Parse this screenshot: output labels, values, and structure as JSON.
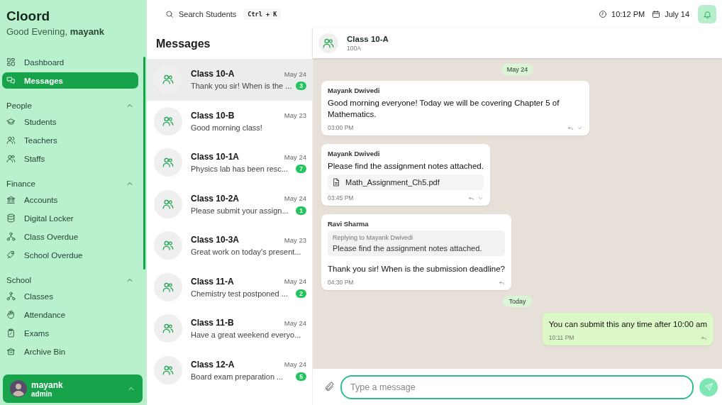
{
  "app": {
    "name": "Cloord",
    "greeting": "Good Evening, **mayank**"
  },
  "sidebar": {
    "items": [
      {
        "label": "Dashboard",
        "selected": false
      },
      {
        "label": "Messages",
        "selected": true
      }
    ],
    "sections": [
      {
        "title": "People",
        "expanded": true,
        "items": [
          {
            "label": "Students",
            "selected": false
          },
          {
            "label": "Teachers",
            "selected": false
          },
          {
            "label": "Staffs",
            "selected": false
          }
        ]
      },
      {
        "title": "Finance",
        "expanded": true,
        "items": [
          {
            "label": "Accounts",
            "selected": false
          },
          {
            "label": "Digital Locker",
            "selected": false
          },
          {
            "label": "Class Overdue",
            "selected": false
          },
          {
            "label": "School Overdue",
            "selected": false
          }
        ]
      },
      {
        "title": "School",
        "expanded": true,
        "items": [
          {
            "label": "Classes",
            "selected": false
          },
          {
            "label": "Attendance",
            "selected": false
          },
          {
            "label": "Exams",
            "selected": false
          },
          {
            "label": "Archive Bin",
            "selected": false
          }
        ]
      }
    ]
  },
  "user": {
    "name": "mayank",
    "role": "admin"
  },
  "topbar": {
    "search": {
      "placeholder": "Search Students",
      "shortcut": "Ctrl + K"
    },
    "time": "10:12 PM",
    "date": "July 14"
  },
  "conversations": {
    "title": "Messages",
    "items": [
      {
        "name": "Class 10-A",
        "date": "May 24",
        "preview": "Thank you sir! When is the ...",
        "unread": "3",
        "selected": true
      },
      {
        "name": "Class 10-B",
        "date": "May 23",
        "preview": "Good morning class!",
        "selected": false
      },
      {
        "name": "Class 10-1A",
        "date": "May 24",
        "preview": "Physics lab has been resc...",
        "unread": "7",
        "selected": false
      },
      {
        "name": "Class 10-2A",
        "date": "May 24",
        "preview": "Please submit your assign...",
        "unread": "1",
        "selected": false
      },
      {
        "name": "Class 10-3A",
        "date": "May 23",
        "preview": "Great work on today's present...",
        "selected": false
      },
      {
        "name": "Class 11-A",
        "date": "May 24",
        "preview": "Chemistry test postponed ...",
        "unread": "2",
        "selected": false
      },
      {
        "name": "Class 11-B",
        "date": "May 24",
        "preview": "Have a great weekend everyo...",
        "selected": false
      },
      {
        "name": "Class 12-A",
        "date": "May 24",
        "preview": "Board exam preparation ...",
        "unread": "5",
        "selected": false
      }
    ]
  },
  "chat": {
    "title": "Class 10-A",
    "subtitle": "100A",
    "messages": [
      {
        "kind": "divider",
        "text": "May 24"
      },
      {
        "kind": "incoming",
        "sender": "Mayank Dwivedi",
        "text": "Good morning everyone! Today we will be covering Chapter 5 of Mathematics.",
        "time": "03:00 PM",
        "menu": true
      },
      {
        "kind": "incoming",
        "sender": "Mayank Dwivedi",
        "text": "Please find the assignment notes attached.",
        "attachment": "Math_Assignment_Ch5.pdf",
        "time": "03:45 PM",
        "menu": true
      },
      {
        "kind": "incoming",
        "sender": "Ravi Sharma",
        "reply_to": {
          "label": "Replying to Mayank Dwivedi",
          "text": "Please find the assignment notes attached."
        },
        "text": "Thank you sir! When is the submission deadline?",
        "time": "04:30 PM",
        "menu": false
      },
      {
        "kind": "divider",
        "text": "Today"
      },
      {
        "kind": "outgoing",
        "text": "You can submit this any time after 10:00 am",
        "time": "10:11 PM",
        "menu": false
      }
    ],
    "composer": {
      "placeholder": "Type a message"
    }
  }
}
